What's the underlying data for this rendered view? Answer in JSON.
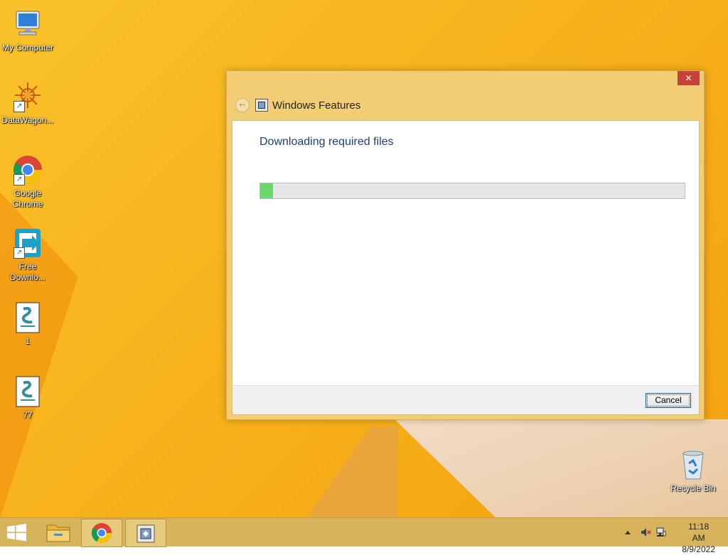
{
  "desktop": {
    "icons": [
      {
        "label": "My Computer",
        "icon": "computer-icon"
      },
      {
        "label": "DataWagon...",
        "icon": "datawagon-icon"
      },
      {
        "label": "Google Chrome",
        "icon": "chrome-icon"
      },
      {
        "label": "Free Downlo...",
        "icon": "download-manager-icon"
      },
      {
        "label": "1",
        "icon": "script-file-icon"
      },
      {
        "label": "77",
        "icon": "script-file-icon"
      },
      {
        "label": "Recycle Bin",
        "icon": "recycle-bin-icon"
      }
    ]
  },
  "window": {
    "title": "Windows Features",
    "close_label": "✕",
    "heading": "Downloading required files",
    "progress_fraction": 0.03,
    "cancel_label": "Cancel"
  },
  "taskbar": {
    "items": [
      {
        "icon": "start-icon"
      },
      {
        "icon": "file-explorer-icon"
      },
      {
        "icon": "chrome-icon"
      },
      {
        "icon": "windows-features-icon"
      }
    ],
    "time": "11:18 AM",
    "date": "8/9/2022"
  },
  "colors": {
    "accent": "#c7413b",
    "heading": "#1f3f7a",
    "progress": "#6ad86a"
  }
}
